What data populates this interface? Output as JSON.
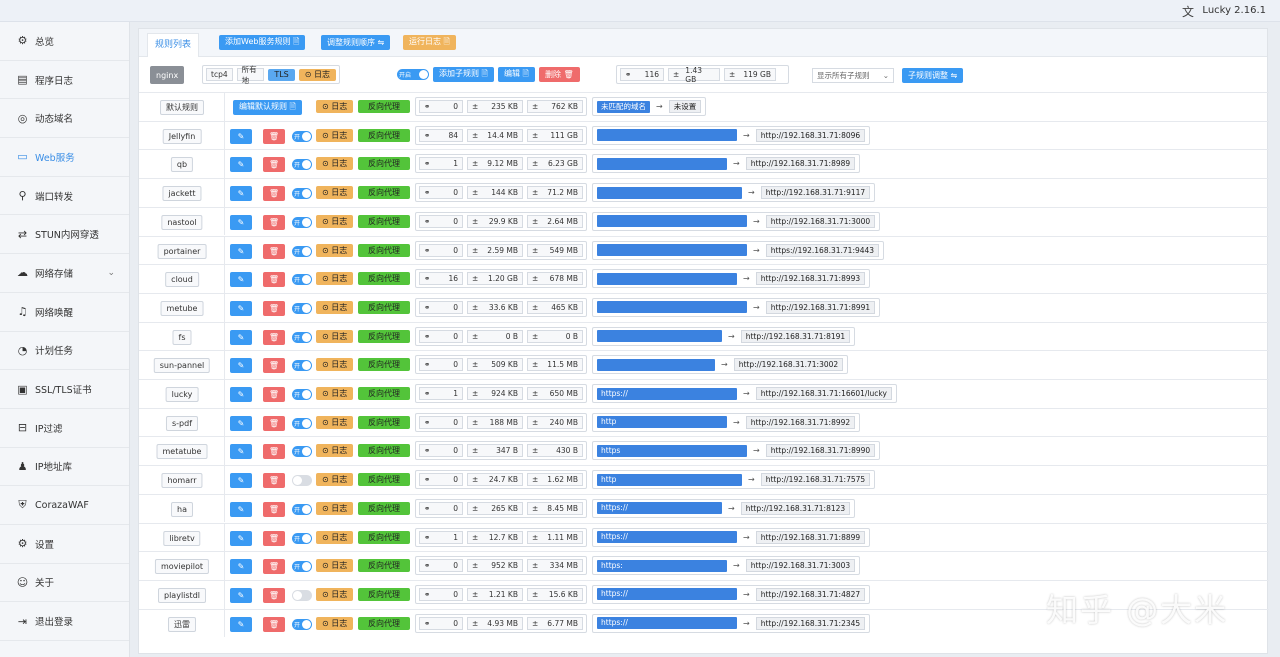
{
  "app": {
    "version": "Lucky 2.16.1",
    "lang_icon": "translate-icon"
  },
  "sidebar": {
    "items": [
      {
        "label": "总览",
        "icon": "⚙"
      },
      {
        "label": "程序日志",
        "icon": "▤"
      },
      {
        "label": "动态域名",
        "icon": "◎"
      },
      {
        "label": "Web服务",
        "icon": "▭",
        "active": true
      },
      {
        "label": "端口转发",
        "icon": "⚲"
      },
      {
        "label": "STUN内网穿透",
        "icon": "⇄"
      },
      {
        "label": "网络存储",
        "icon": "☁",
        "chevron": true
      },
      {
        "label": "网络唤醒",
        "icon": "♫"
      },
      {
        "label": "计划任务",
        "icon": "◔"
      },
      {
        "label": "SSL/TLS证书",
        "icon": "▣"
      },
      {
        "label": "IP过滤",
        "icon": "⊟"
      },
      {
        "label": "IP地址库",
        "icon": "♟"
      },
      {
        "label": "CorazaWAF",
        "icon": "⛨"
      },
      {
        "label": "设置",
        "icon": "⚙"
      },
      {
        "label": "关于",
        "icon": "☺"
      },
      {
        "label": "退出登录",
        "icon": "⇥"
      }
    ]
  },
  "toolbar": {
    "tab": "规则列表",
    "add": "添加Web服务规则 🗎",
    "reorder": "调整规则顺序 ⇋",
    "logs": "运行日志 🗎"
  },
  "header": {
    "name": "nginx",
    "proto": "tcp4",
    "addr": "所有地",
    "tls": "TLS",
    "log": "⊙ 日志",
    "toggle": "开启",
    "add_sub": "添加子规则 🗎",
    "edit": "编辑 🗎",
    "del": "删除 🗑",
    "conns": "116",
    "in": "1.43 GB",
    "out": "119 GB",
    "select": "显示所有子规则",
    "adjust": "子规则调整 ⇋"
  },
  "labels": {
    "log": "⊙ 日志",
    "proxy": "反向代理",
    "edit_default": "编辑默认规则 🗎",
    "toggle_on": "开",
    "unmatched": "未匹配的域名",
    "unset": "未设置"
  },
  "default_rule": {
    "name": "默认规则",
    "conns": "0",
    "in": "235 KB",
    "out": "762 KB"
  },
  "rules": [
    {
      "name": "Jellyfin",
      "on": true,
      "conns": "84",
      "in": "14.4 MB",
      "out": "111 GB",
      "domain": "",
      "target": "http://192.168.31.71:8096",
      "dw": 140
    },
    {
      "name": "qb",
      "on": true,
      "conns": "1",
      "in": "9.12 MB",
      "out": "6.23 GB",
      "domain": "",
      "target": "http://192.168.31.71:8989",
      "dw": 130
    },
    {
      "name": "jackett",
      "on": true,
      "conns": "0",
      "in": "144 KB",
      "out": "71.2 MB",
      "domain": "",
      "target": "http://192.168.31.71:9117",
      "dw": 145
    },
    {
      "name": "nastool",
      "on": true,
      "conns": "0",
      "in": "29.9 KB",
      "out": "2.64 MB",
      "domain": "",
      "target": "http://192.168.31.71:3000",
      "dw": 150
    },
    {
      "name": "portainer",
      "on": true,
      "conns": "0",
      "in": "2.59 MB",
      "out": "549 MB",
      "domain": "",
      "target": "https://192.168.31.71:9443",
      "dw": 150
    },
    {
      "name": "cloud",
      "on": true,
      "conns": "16",
      "in": "1.20 GB",
      "out": "678 MB",
      "domain": "",
      "target": "http://192.168.31.71:8993",
      "dw": 140
    },
    {
      "name": "metube",
      "on": true,
      "conns": "0",
      "in": "33.6 KB",
      "out": "465 KB",
      "domain": "",
      "target": "http://192.168.31.71:8991",
      "dw": 150
    },
    {
      "name": "fs",
      "on": true,
      "conns": "0",
      "in": "0 B",
      "out": "0 B",
      "domain": "",
      "target": "http://192.168.31.71:8191",
      "dw": 125
    },
    {
      "name": "sun-pannel",
      "on": true,
      "conns": "0",
      "in": "509 KB",
      "out": "11.5 MB",
      "domain": "",
      "target": "http://192.168.31.71:3002",
      "dw": 118
    },
    {
      "name": "lucky",
      "on": true,
      "conns": "1",
      "in": "924 KB",
      "out": "650 MB",
      "domain": "https://",
      "target": "http://192.168.31.71:16601/lucky",
      "dw": 140
    },
    {
      "name": "s-pdf",
      "on": true,
      "conns": "0",
      "in": "188 MB",
      "out": "240 MB",
      "domain": "http",
      "target": "http://192.168.31.71:8992",
      "dw": 130
    },
    {
      "name": "metatube",
      "on": true,
      "conns": "0",
      "in": "347 B",
      "out": "430 B",
      "domain": "https",
      "target": "http://192.168.31.71:8990",
      "dw": 150
    },
    {
      "name": "homarr",
      "on": false,
      "conns": "0",
      "in": "24.7 KB",
      "out": "1.62 MB",
      "domain": "http",
      "target": "http://192.168.31.71:7575",
      "dw": 145
    },
    {
      "name": "ha",
      "on": true,
      "conns": "0",
      "in": "265 KB",
      "out": "8.45 MB",
      "domain": "https://",
      "target": "http://192.168.31.71:8123",
      "dw": 125
    },
    {
      "name": "libretv",
      "on": true,
      "conns": "1",
      "in": "12.7 KB",
      "out": "1.11 MB",
      "domain": "https://",
      "target": "http://192.168.31.71:8899",
      "dw": 140
    },
    {
      "name": "moviepilot",
      "on": true,
      "conns": "0",
      "in": "952 KB",
      "out": "334 MB",
      "domain": "https:",
      "target": "http://192.168.31.71:3003",
      "dw": 130
    },
    {
      "name": "playlistdl",
      "on": false,
      "conns": "0",
      "in": "1.21 KB",
      "out": "15.6 KB",
      "domain": "https://",
      "target": "http://192.168.31.71:4827",
      "dw": 140
    },
    {
      "name": "迅雷",
      "on": true,
      "conns": "0",
      "in": "4.93 MB",
      "out": "6.77 MB",
      "domain": "https://",
      "target": "http://192.168.31.71:2345",
      "dw": 140
    }
  ],
  "watermark": "知乎 @大米"
}
